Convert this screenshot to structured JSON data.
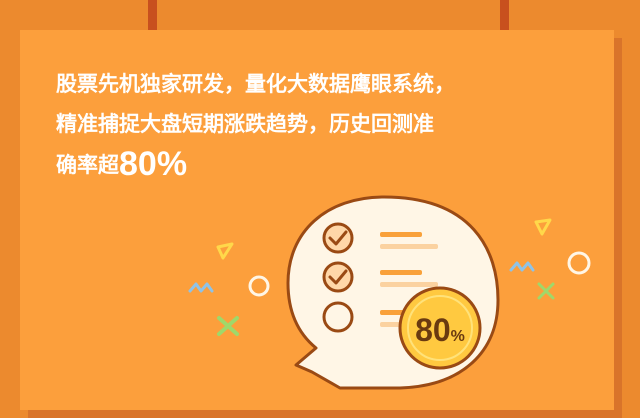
{
  "headline": {
    "line1": "股票先机独家研发，量化大数据鹰眼系统，",
    "line2": "精准捕捉大盘短期涨跌趋势，历史回测准",
    "line3_prefix": "确率超",
    "line3_value": "80%"
  },
  "badge": {
    "value": "80",
    "unit": "%"
  },
  "checklist": {
    "checked_count": 2,
    "total": 3
  },
  "colors": {
    "background": "#ec8a2e",
    "card": "#fc9f3c",
    "stripe": "#c8501e",
    "bubble": "#fff6e6",
    "outline": "#9a4a14",
    "badge": "#ffc940",
    "check": "#f9a13a",
    "deco_green": "#9fd86a",
    "deco_yellow": "#ffd84a",
    "deco_blue": "#8ec3e8"
  },
  "icons": [
    "speech-bubble-icon",
    "check-circle-icon",
    "empty-circle-icon",
    "percent-badge-icon",
    "sparkle-icon"
  ]
}
